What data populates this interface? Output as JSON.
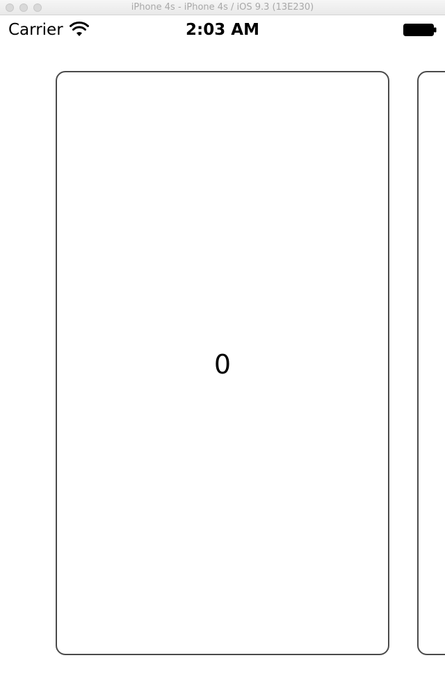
{
  "window": {
    "title": "iPhone 4s - iPhone 4s / iOS 9.3 (13E230)"
  },
  "status_bar": {
    "carrier": "Carrier",
    "time": "2:03 AM",
    "icons": [
      "wifi-icon",
      "battery-icon"
    ]
  },
  "cards": [
    {
      "number": "0"
    },
    {
      "number": ""
    }
  ],
  "colors": {
    "card_border": "#4a4a4a",
    "background": "#ffffff"
  }
}
